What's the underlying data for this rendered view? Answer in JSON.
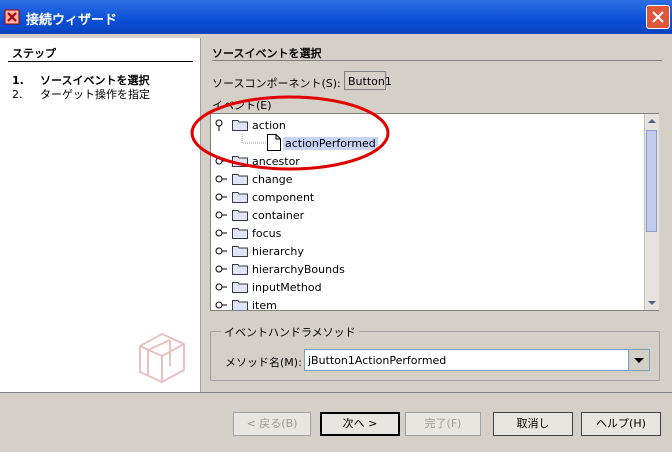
{
  "window": {
    "title": "接続ウィザード"
  },
  "steps": {
    "title": "ステップ",
    "items": [
      {
        "num": "1.",
        "label": "ソースイベントを選択"
      },
      {
        "num": "2.",
        "label": "ターゲット操作を指定"
      }
    ]
  },
  "main": {
    "title": "ソースイベントを選択",
    "source_component_label": "ソースコンポーネント(S):",
    "source_component_value": "Button1",
    "event_label": "イベント(E)"
  },
  "tree": {
    "items": [
      {
        "label": "action",
        "expanded": true
      },
      {
        "label": "actionPerformed",
        "child": true,
        "selected": true
      },
      {
        "label": "ancestor"
      },
      {
        "label": "change"
      },
      {
        "label": "component"
      },
      {
        "label": "container"
      },
      {
        "label": "focus"
      },
      {
        "label": "hierarchy"
      },
      {
        "label": "hierarchyBounds"
      },
      {
        "label": "inputMethod"
      },
      {
        "label": "item"
      }
    ]
  },
  "handler": {
    "group_title": "イベントハンドラメソッド",
    "method_label": "メソッド名(M):",
    "method_value": "jButton1ActionPerformed"
  },
  "buttons": {
    "back": "< 戻る(B)",
    "next": "次へ >",
    "finish": "完了(F)",
    "cancel": "取消し",
    "help": "ヘルプ(H)"
  },
  "colors": {
    "title_bar": "#0a4fd6",
    "selection": "#c9d4f5",
    "annotation": "#e00000"
  }
}
